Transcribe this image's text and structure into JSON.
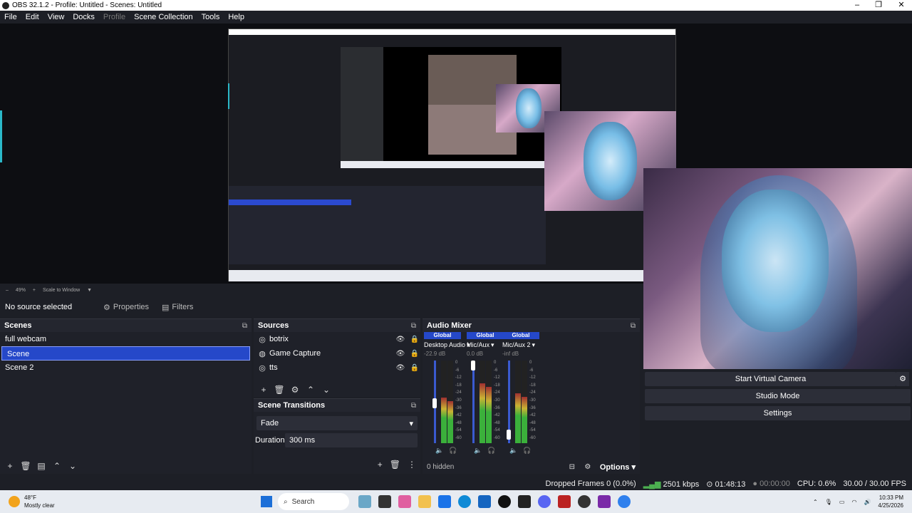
{
  "window": {
    "title": "OBS 32.1.2 - Profile: Untitled - Scenes: Untitled"
  },
  "menu": [
    "File",
    "Edit",
    "View",
    "Docks",
    "Profile",
    "Scene Collection",
    "Tools",
    "Help"
  ],
  "zoom": {
    "level": "49%",
    "mode": "Scale to Window"
  },
  "context": {
    "no_source": "No source selected",
    "properties": "Properties",
    "filters": "Filters"
  },
  "scenes": {
    "title": "Scenes",
    "items": [
      "full webcam",
      "Scene",
      "Scene 2"
    ],
    "selected": 1
  },
  "sources": {
    "title": "Sources",
    "items": [
      "botrix",
      "Game Capture",
      "tts"
    ]
  },
  "transitions": {
    "title": "Scene Transitions",
    "type": "Fade",
    "duration_label": "Duration",
    "duration": "300 ms"
  },
  "audio": {
    "title": "Audio Mixer",
    "channels": [
      {
        "global": "Global",
        "name": "Desktop Audio",
        "db": "-22.9 dB",
        "level": 0.55,
        "fader": 0.48
      },
      {
        "global": "Global",
        "name": "Mic/Aux",
        "db": "0.0 dB",
        "level": 0.72,
        "fader": 1.0
      },
      {
        "global": "Global",
        "name": "Mic/Aux 2",
        "db": "-inf dB",
        "level": 0.6,
        "fader": 0.05
      }
    ],
    "ticks": [
      "0",
      "-6",
      "-12",
      "-18",
      "-24",
      "-30",
      "-36",
      "-42",
      "-48",
      "-54",
      "-60"
    ],
    "hidden": "0 hidden",
    "options": "Options"
  },
  "controls": {
    "vcam": "Start Virtual Camera",
    "studio": "Studio Mode",
    "settings": "Settings"
  },
  "status": {
    "dropped": "Dropped Frames 0 (0.0%)",
    "bitrate": "2501 kbps",
    "stream_time": "01:48:13",
    "rec_time": "00:00:00",
    "cpu": "CPU: 0.6%",
    "fps": "30.00 / 30.00 FPS"
  },
  "taskbar": {
    "temp": "48°F",
    "weather": "Mostly clear",
    "search": "Search",
    "time": "10:33 PM",
    "date": "4/25/2026"
  },
  "colors": {
    "accent": "#2548c9",
    "panel": "#1f2129",
    "bg": "#1d1f26"
  }
}
